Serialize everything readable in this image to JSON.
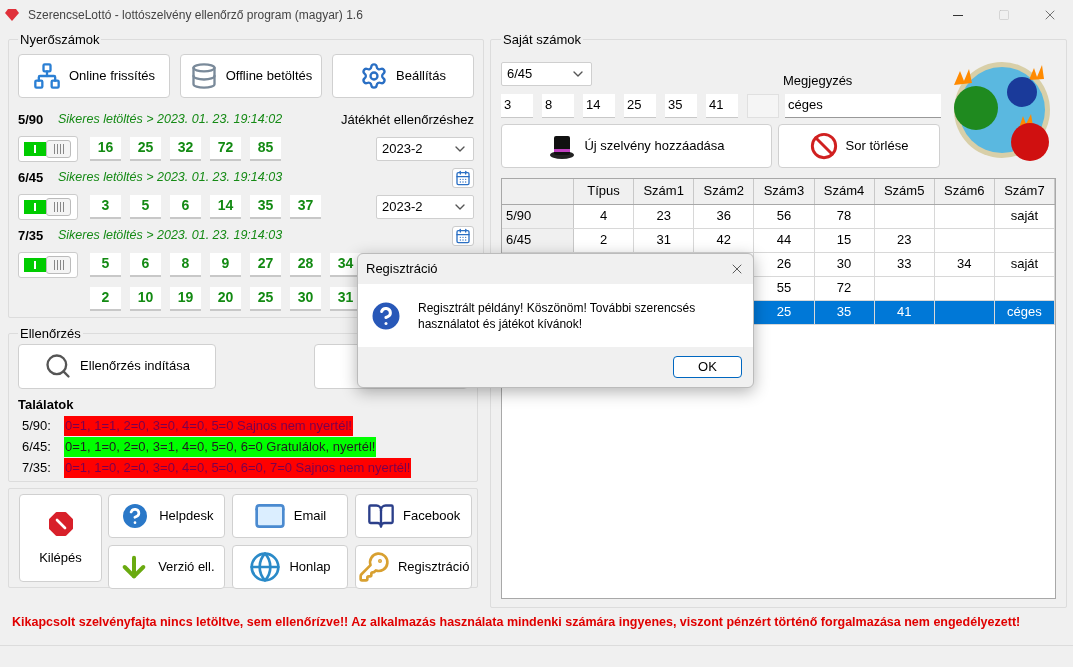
{
  "window": {
    "title": "SzerencseLottó - lottószelvény ellenőrző program (magyar) 1.6"
  },
  "winning_numbers": {
    "title": "Nyerőszámok",
    "buttons": [
      {
        "kind": "online",
        "label": "Online frissítés"
      },
      {
        "kind": "offline",
        "label": "Offline betöltés"
      },
      {
        "kind": "settings",
        "label": "Beállítás"
      }
    ],
    "week_label": "Játékhét ellenőrzéshez",
    "games": [
      {
        "name": "5/90",
        "status": "Sikeres letöltés > 2023. 01. 23. 19:14:02",
        "on": true,
        "number_rows": [
          [
            "16",
            "25",
            "32",
            "72",
            "85"
          ]
        ],
        "week": "2023-2"
      },
      {
        "name": "6/45",
        "status": "Sikeres letöltés > 2023. 01. 23. 19:14:03",
        "on": true,
        "number_rows": [
          [
            "3",
            "5",
            "6",
            "14",
            "35",
            "37"
          ]
        ],
        "week": "2023-2"
      },
      {
        "name": "7/35",
        "status": "Sikeres letöltés > 2023. 01. 23. 19:14:03",
        "on": true,
        "number_rows": [
          [
            "5",
            "6",
            "8",
            "9",
            "27",
            "28",
            "34"
          ],
          [
            "2",
            "10",
            "19",
            "20",
            "25",
            "30",
            "31"
          ]
        ]
      }
    ]
  },
  "check": {
    "title": "Ellenőrzés",
    "start_button": "Ellenőrzés indítása",
    "results_title": "Találatok",
    "results": [
      {
        "game": "5/90:",
        "text": "0=1, 1=1, 2=0, 3=0, 4=0, 5=0 Sajnos nem nyertél!",
        "won": false
      },
      {
        "game": "6/45:",
        "text": "0=1, 1=0, 2=0, 3=1, 4=0, 5=0, 6=0 Gratulálok, nyertél!",
        "won": true
      },
      {
        "game": "7/35:",
        "text": "0=1, 1=0, 2=0, 3=0, 4=0, 5=0, 6=0, 7=0 Sajnos nem nyertél!",
        "won": false
      }
    ]
  },
  "actions": [
    {
      "kind": "exit",
      "label": "Kilépés"
    },
    {
      "kind": "help",
      "label": "Helpdesk"
    },
    {
      "kind": "email",
      "label": "Email"
    },
    {
      "kind": "facebook",
      "label": "Facebook"
    },
    {
      "kind": "version",
      "label": "Verzió ell."
    },
    {
      "kind": "web",
      "label": "Honlap"
    },
    {
      "kind": "register",
      "label": "Regisztráció"
    }
  ],
  "footer": "Kikapcsolt szelvényfajta nincs letöltve, sem ellenőrízve!!  Az alkalmazás használata mindenki számára ingyenes, viszont pénzért történő forgalmazása nem engedélyezett!",
  "own_numbers": {
    "title": "Saját számok",
    "type": "6/45",
    "note_label": "Megjegyzés",
    "note": "céges",
    "fields": [
      {
        "value": "3",
        "disabled": false
      },
      {
        "value": "8",
        "disabled": false
      },
      {
        "value": "14",
        "disabled": false
      },
      {
        "value": "25",
        "disabled": false
      },
      {
        "value": "35",
        "disabled": false
      },
      {
        "value": "41",
        "disabled": false
      },
      {
        "disabled": true
      }
    ],
    "add_button": "Új szelvény hozzáadása",
    "delete_button": "Sor törlése"
  },
  "table": {
    "columns": [
      "Típus",
      "Szám1",
      "Szám2",
      "Szám3",
      "Szám4",
      "Szám5",
      "Szám6",
      "Szám7"
    ],
    "rows": [
      {
        "header": "5/90",
        "cells": [
          "4",
          "23",
          "36",
          "56",
          "78",
          null,
          null,
          "saját"
        ],
        "selected": false
      },
      {
        "header": "6/45",
        "cells": [
          "2",
          "31",
          "42",
          "44",
          "15",
          "23",
          null,
          null
        ],
        "selected": false
      },
      {
        "cells": [
          null,
          null,
          null,
          "26",
          "30",
          "33",
          "34",
          "saját"
        ],
        "selected": false
      },
      {
        "cells": [
          null,
          null,
          null,
          "55",
          "72",
          null,
          null,
          null
        ],
        "selected": false
      },
      {
        "cells": [
          null,
          null,
          null,
          "25",
          "35",
          "41",
          null,
          "céges"
        ],
        "selected": true
      }
    ]
  },
  "dialog": {
    "title": "Regisztráció",
    "message": "Regisztrált példány! Köszönöm! További szerencsés használatot és játékot kívánok!",
    "ok": "OK"
  }
}
